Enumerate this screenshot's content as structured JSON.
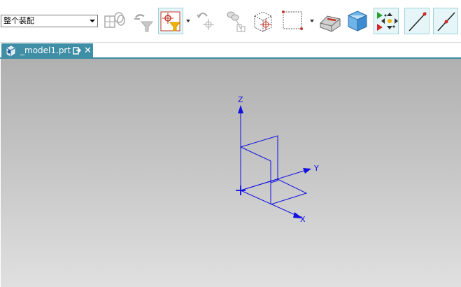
{
  "toolbar": {
    "selection_filter": {
      "value": "整个装配"
    },
    "icons": [
      "assembly-navigator-icon",
      "filter-off-icon",
      "selection-filter-icon",
      "undo-icon",
      "snap-point-icon",
      "component-selection-icon",
      "box-select-icon",
      "shaded-with-edges-icon",
      "view-orientation-icon",
      "snap-control-icon",
      "line-endpoint-icon",
      "line-midpoint-icon"
    ]
  },
  "tabs": [
    {
      "label": "_model1.prt",
      "close": "✕",
      "active": true
    }
  ],
  "viewport": {
    "background_top": "#b0b0b0",
    "background_bottom": "#e0e0e0",
    "csys_color": "#1010e0",
    "axes": {
      "x": "X",
      "y": "Y",
      "z": "Z"
    }
  }
}
